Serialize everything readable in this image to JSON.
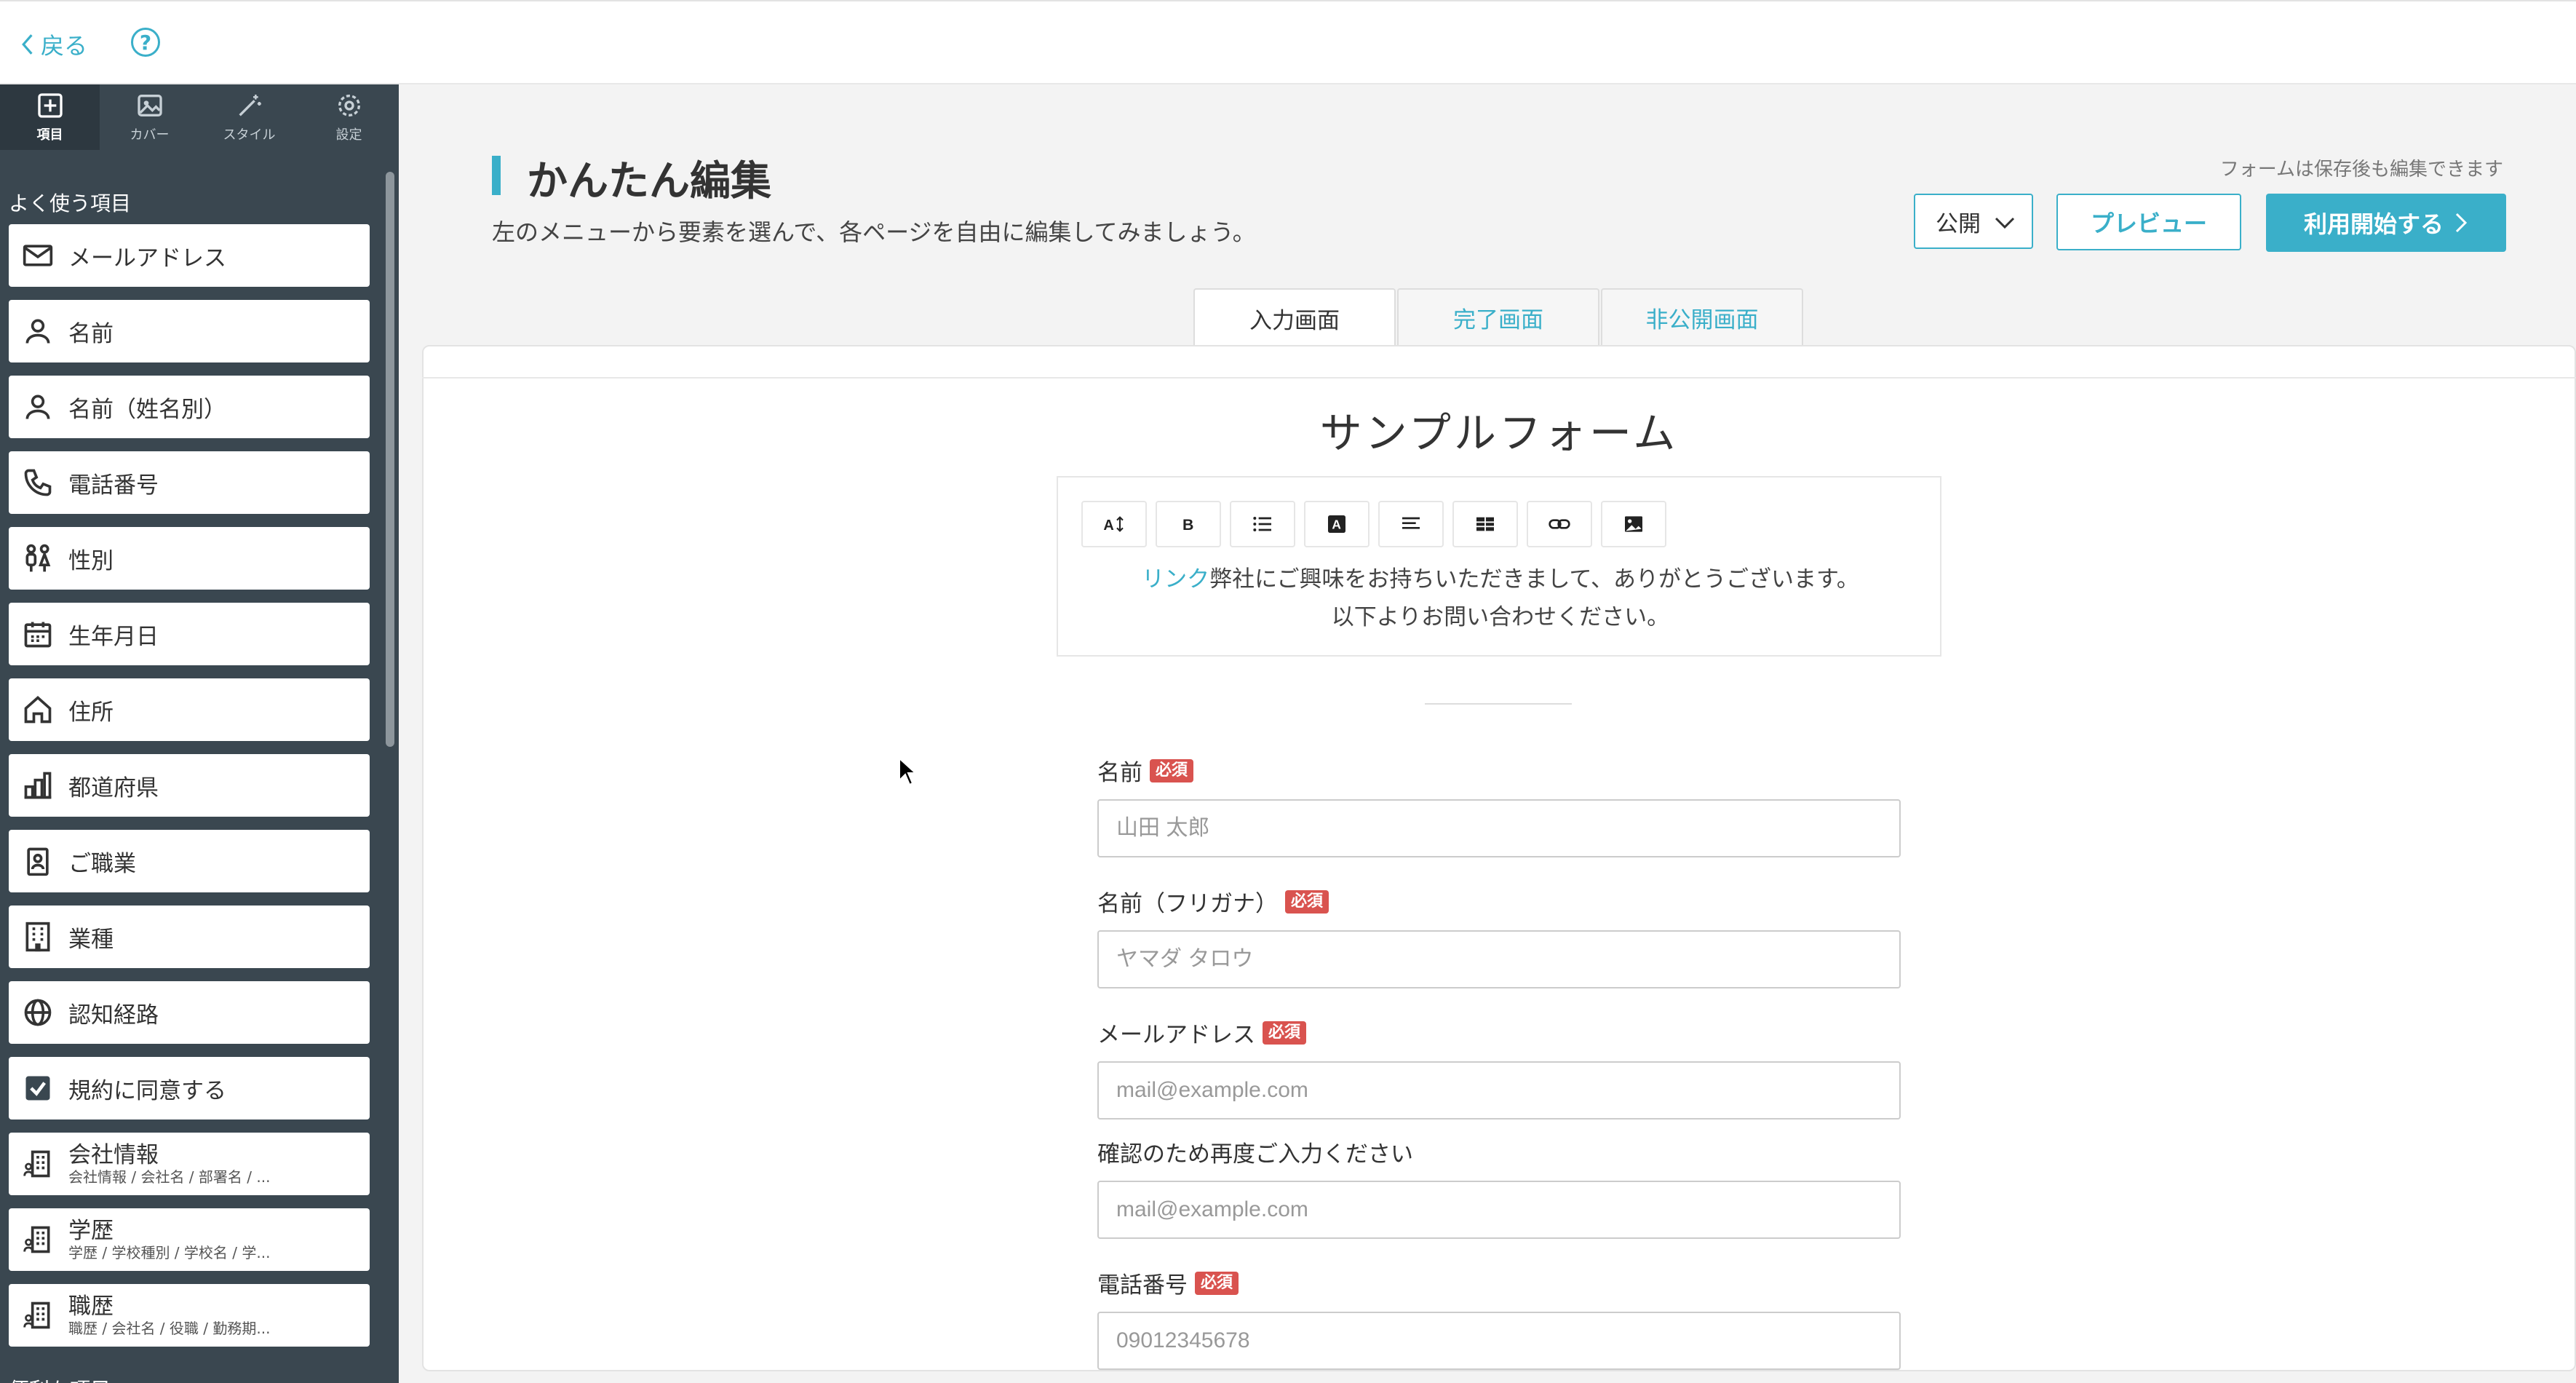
{
  "topbar": {
    "back_label": "戻る",
    "help_label": "?"
  },
  "sidebar": {
    "tabs": [
      {
        "label": "項目",
        "icon": "plus-square-icon"
      },
      {
        "label": "カバー",
        "icon": "image-icon"
      },
      {
        "label": "スタイル",
        "icon": "magic-wand-icon"
      },
      {
        "label": "設定",
        "icon": "gear-icon"
      }
    ],
    "group_frequent": "よく使う項目",
    "items": [
      {
        "label": "メールアドレス",
        "icon": "envelope-icon"
      },
      {
        "label": "名前",
        "icon": "person-icon"
      },
      {
        "label": "名前（姓名別）",
        "icon": "person-icon"
      },
      {
        "label": "電話番号",
        "icon": "phone-icon"
      },
      {
        "label": "性別",
        "icon": "gender-icon"
      },
      {
        "label": "生年月日",
        "icon": "calendar-icon"
      },
      {
        "label": "住所",
        "icon": "house-icon"
      },
      {
        "label": "都道府県",
        "icon": "buildings-icon"
      },
      {
        "label": "ご職業",
        "icon": "id-badge-icon"
      },
      {
        "label": "業種",
        "icon": "office-building-icon"
      },
      {
        "label": "認知経路",
        "icon": "globe-icon"
      },
      {
        "label": "規約に同意する",
        "icon": "checkbox-icon"
      },
      {
        "label": "会社情報",
        "sub": "会社情報 / 会社名 / 部署名 / ...",
        "icon": "company-icon"
      },
      {
        "label": "学歴",
        "sub": "学歴 / 学校種別 / 学校名 / 学...",
        "icon": "company-icon"
      },
      {
        "label": "職歴",
        "sub": "職歴 / 会社名 / 役職 / 勤務期...",
        "icon": "company-icon"
      }
    ],
    "group_convenient": "便利な項目"
  },
  "main": {
    "title": "かんたん編集",
    "subtitle": "左のメニューから要素を選んで、各ページを自由に編集してみましょう。",
    "note": "フォームは保存後も編集できます",
    "visibility_select": "公開",
    "preview_label": "プレビュー",
    "start_label": "利用開始する",
    "tabs": [
      {
        "label": "入力画面",
        "active": true
      },
      {
        "label": "完了画面",
        "active": false
      },
      {
        "label": "非公開画面",
        "active": false
      }
    ]
  },
  "form": {
    "title": "サンプルフォーム",
    "toolbar": [
      "font-size-icon",
      "bold-icon",
      "list-icon",
      "text-color-icon",
      "align-icon",
      "table-icon",
      "link-icon",
      "image-icon"
    ],
    "intro_link": "リンク",
    "intro_line1": "弊社にご興味をお持ちいただきまして、ありがとうございます。",
    "intro_line2": "以下よりお問い合わせください。",
    "required_badge": "必須",
    "fields": [
      {
        "label": "名前",
        "placeholder": "山田 太郎",
        "required": true
      },
      {
        "label": "名前（フリガナ）",
        "placeholder": "ヤマダ タロウ",
        "required": true
      },
      {
        "label": "メールアドレス",
        "placeholder": "mail@example.com",
        "required": true
      },
      {
        "label": "確認のため再度ご入力ください",
        "placeholder": "mail@example.com",
        "required": false
      },
      {
        "label": "電話番号",
        "placeholder": "09012345678",
        "required": true
      }
    ]
  },
  "colors": {
    "accent": "#3aafc9",
    "sidebar": "#3a4750",
    "required": "#d9534f"
  }
}
